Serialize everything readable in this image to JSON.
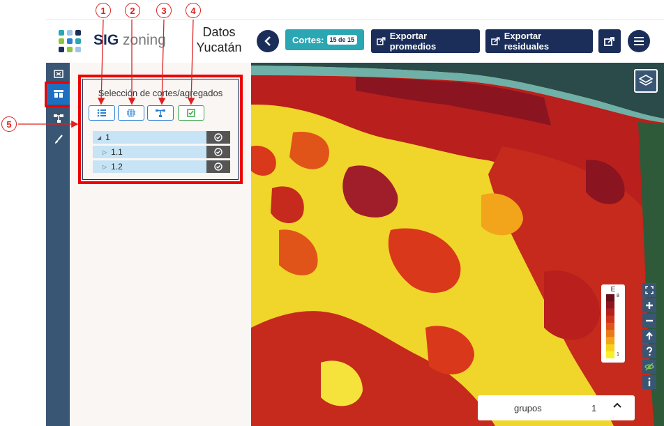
{
  "app": {
    "logo_prefix": "SIG",
    "logo_suffix": "zoning",
    "title_line1": "Datos",
    "title_line2": "Yucatán"
  },
  "header": {
    "back_icon": "chevron-left-icon",
    "cortes_label": "Cortes:",
    "cortes_badge": "15 de 15",
    "export_promedios": "Exportar promedios",
    "export_residuales": "Exportar residuales",
    "share_icon": "share-icon",
    "menu_icon": "hamburger-menu-icon",
    "accent_color": "#1b2e5a",
    "teal_color": "#2aa7b3"
  },
  "sidebar": {
    "icons": [
      "map-frame-icon",
      "cuts-icon",
      "hierarchy-icon",
      "brush-icon"
    ],
    "active_index": 1
  },
  "panel": {
    "title": "Selección de cortes/agregados",
    "tools": [
      "list-icon",
      "globe-icon",
      "hierarchy-icon",
      "checkbox-icon"
    ],
    "tree": [
      {
        "label": "1",
        "level": 0,
        "expanded": true
      },
      {
        "label": "1.1",
        "level": 1,
        "expanded": false
      },
      {
        "label": "1.2",
        "level": 1,
        "expanded": false
      }
    ]
  },
  "map": {
    "legend_title": "E",
    "legend_max": "8",
    "legend_min": "1",
    "legend_colors": [
      "#6b0f1a",
      "#8c1620",
      "#b3201d",
      "#d0331c",
      "#e0541a",
      "#ea7a18",
      "#f2a41a",
      "#f5d21c",
      "#f7ef2a"
    ],
    "controls": [
      "fullscreen-icon",
      "zoom-in-icon",
      "zoom-out-icon",
      "arrow-up-icon",
      "help-icon",
      "eye-off-icon",
      "info-icon"
    ],
    "groups_label": "grupos",
    "groups_count": "1",
    "groups_chevron": "chevron-up-icon"
  },
  "callouts": [
    "1",
    "2",
    "3",
    "4",
    "5"
  ]
}
